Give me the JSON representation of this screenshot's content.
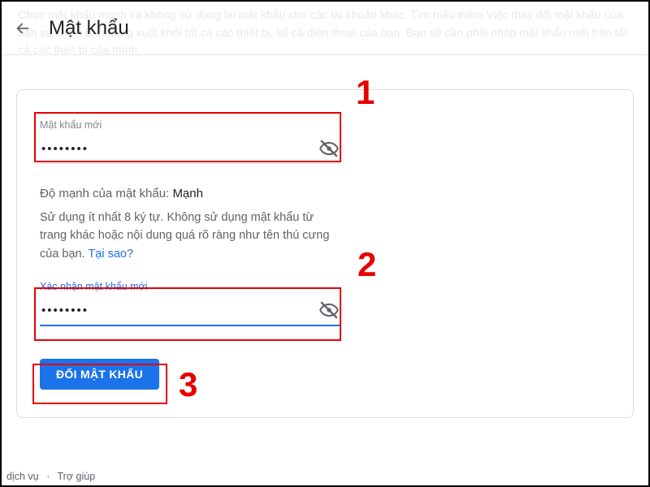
{
  "bg_text": "Chọn mật khẩu mạnh và không sử dụng lại mật khẩu cho các tài khoản khác. Tìm hiểu thêm\nViệc thay đổi mật khẩu của bạn sẽ khiến bạn đăng xuất khỏi tất cả các thiết bị, kể cả điện thoại của bạn. Bạn sẽ cần phải nhập mật khẩu mới trên tất cả các thiết bị của mình.",
  "header": {
    "title": "Mật khẩu"
  },
  "field1": {
    "label": "Mật khẩu mới",
    "value": "••••••••"
  },
  "strength": {
    "label": "Độ mạnh của mật khẩu:",
    "value": "Mạnh"
  },
  "hint": {
    "text": "Sử dụng ít nhất 8 ký tự. Không sử dụng mật khẩu từ trang khác hoặc nội dung quá rõ ràng như tên thú cưng của bạn. ",
    "link": "Tại sao?"
  },
  "field2": {
    "label": "Xác nhận mật khẩu mới",
    "value": "••••••••"
  },
  "submit": {
    "label": "ĐỔI MẬT KHẨU"
  },
  "footer": {
    "a": "dịch vụ",
    "b": "Trợ giúp"
  },
  "anno": {
    "n1": "1",
    "n2": "2",
    "n3": "3"
  }
}
